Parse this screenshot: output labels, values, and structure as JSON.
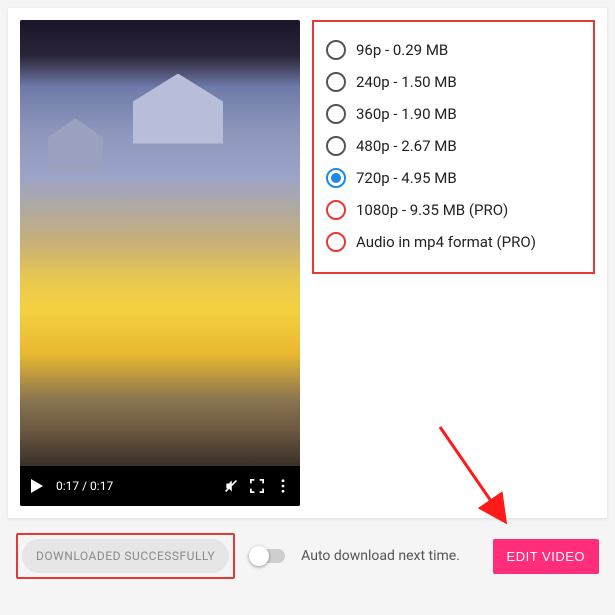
{
  "video": {
    "current_time": "0:17",
    "duration": "0:17"
  },
  "quality_options": [
    {
      "label": "96p - 0.29 MB",
      "state": "normal"
    },
    {
      "label": "240p - 1.50 MB",
      "state": "normal"
    },
    {
      "label": "360p - 1.90 MB",
      "state": "normal"
    },
    {
      "label": "480p - 2.67 MB",
      "state": "normal"
    },
    {
      "label": "720p - 4.95 MB",
      "state": "selected"
    },
    {
      "label": "1080p - 9.35 MB (PRO)",
      "state": "pro"
    },
    {
      "label": "Audio in mp4 format (PRO)",
      "state": "pro"
    }
  ],
  "status_pill": "DOWNLOADED SUCCESSFULLY",
  "auto_toggle_label": "Auto download next time.",
  "edit_button": "EDIT VIDEO",
  "time_separator": " / "
}
